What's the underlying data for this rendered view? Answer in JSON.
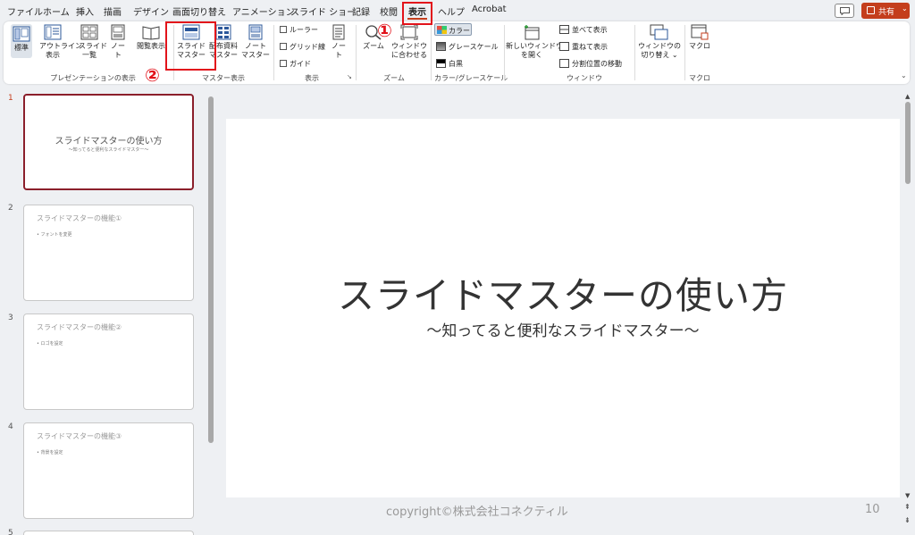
{
  "menu": {
    "tabs": [
      "ファイル",
      "ホーム",
      "挿入",
      "描画",
      "デザイン",
      "画面切り替え",
      "アニメーション",
      "スライド ショー",
      "記録",
      "校閲",
      "表示",
      "ヘルプ",
      "Acrobat"
    ],
    "active_tab": "表示",
    "share_label": "共有",
    "accent_color": "#c43e1c"
  },
  "ribbon": {
    "presentation_views": {
      "normal": "標準",
      "outline_1": "アウトライン",
      "outline_2": "表示",
      "slide_sorter_1": "スライド",
      "slide_sorter_2": "一覧",
      "notes_page_1": "ノー",
      "notes_page_2": "ト",
      "reading_view": "閲覧表示",
      "group_label": "プレゼンテーションの表示"
    },
    "master_views": {
      "slide_master_1": "スライド",
      "slide_master_2": "マスター",
      "handout_master_1": "配布資料",
      "handout_master_2": "マスター",
      "notes_master_1": "ノート",
      "notes_master_2": "マスター",
      "group_label": "マスター表示"
    },
    "show": {
      "ruler": "ルーラー",
      "gridlines": "グリッド線",
      "guides": "ガイド",
      "notes_1": "ノー",
      "notes_2": "ト",
      "group_label": "表示"
    },
    "zoom": {
      "zoom": "ズーム",
      "fit_1": "ウィンドウ",
      "fit_2": "に合わせる",
      "group_label": "ズーム"
    },
    "color": {
      "color": "カラー",
      "grayscale": "グレースケール",
      "bw": "白黒",
      "group_label": "カラー/グレースケール"
    },
    "window": {
      "new_window_1": "新しいウィンドウ",
      "new_window_2": "を開く",
      "arrange_all": "並べて表示",
      "cascade": "重ねて表示",
      "move_split": "分割位置の移動",
      "group_label": "ウィンドウ"
    },
    "switch": {
      "switch_1": "ウィンドウの",
      "switch_2": "切り替え ⌄"
    },
    "macros": {
      "macros": "マクロ",
      "group_label": "マクロ"
    }
  },
  "annotations": {
    "step1": "①",
    "step2": "②"
  },
  "thumbnails": [
    {
      "number": "1",
      "title": "スライドマスターの使い方",
      "subtitle": "〜知ってると便利なスライドマスター〜"
    },
    {
      "number": "2",
      "title": "スライドマスターの機能①",
      "bullet": "• フォントを変更"
    },
    {
      "number": "3",
      "title": "スライドマスターの機能②",
      "bullet": "• ロゴを設定"
    },
    {
      "number": "4",
      "title": "スライドマスターの機能③",
      "bullet": "• 背景を設定"
    },
    {
      "number": "5"
    }
  ],
  "slide": {
    "title": "スライドマスターの使い方",
    "subtitle": "〜知ってると便利なスライドマスター〜",
    "copyright": "copyright©株式会社コネクティル",
    "page_number": "10"
  }
}
